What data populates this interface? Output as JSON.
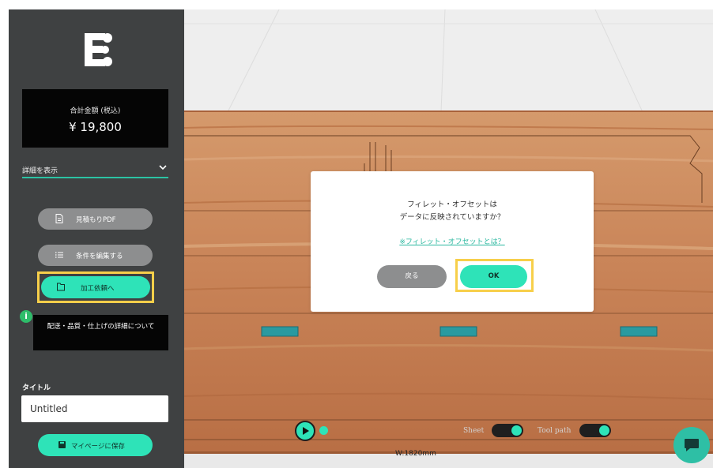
{
  "colors": {
    "accent": "#2ee3b8",
    "highlight": "#f7cf4a",
    "sidebar_bg": "#3f4142",
    "info_green": "#2ebd6a"
  },
  "sidebar": {
    "logo_icon": "brand-logo",
    "total_label": "合計金額 (税込)",
    "total_value": "¥ 19,800",
    "details_label": "詳細を表示",
    "details_icon": "chevron-down-icon",
    "quote_pdf_label": "見積もりPDF",
    "quote_pdf_icon": "document-icon",
    "edit_conditions_label": "条件を編集する",
    "edit_conditions_icon": "list-icon",
    "request_label": "加工依頼へ",
    "request_icon": "folder-icon",
    "info_icon": "info-icon",
    "info_badge": "i",
    "info_text": "配送・品質・仕上げの詳細について",
    "title_label": "タイトル",
    "title_value": "Untitled",
    "save_label": "マイページに保存",
    "save_icon": "save-icon"
  },
  "dialog": {
    "line1": "フィレット・オフセットは",
    "line2": "データに反映されていますか？",
    "link": "※フィレット・オフセットとは？",
    "back_label": "戻る",
    "ok_label": "OK"
  },
  "viewer": {
    "sheet_label": "Sheet",
    "toolpath_label": "Tool path",
    "sheet_on": true,
    "toolpath_on": true,
    "width_label": "W:1820mm",
    "play_icon": "play-icon",
    "chat_icon": "chat-icon"
  }
}
